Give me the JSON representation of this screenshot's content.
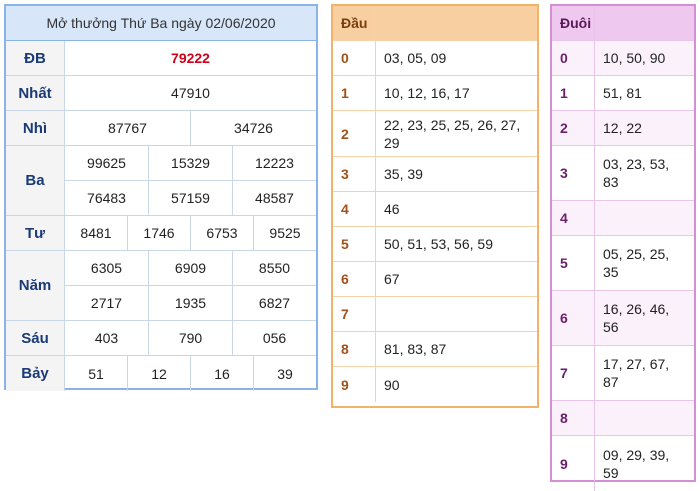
{
  "results": {
    "title": "Mở thưởng Thứ Ba ngày 02/06/2020",
    "prizes": [
      {
        "label": "ĐB",
        "lines": [
          [
            "79222"
          ]
        ],
        "special": true
      },
      {
        "label": "Nhất",
        "lines": [
          [
            "47910"
          ]
        ]
      },
      {
        "label": "Nhì",
        "lines": [
          [
            "87767",
            "34726"
          ]
        ]
      },
      {
        "label": "Ba",
        "lines": [
          [
            "99625",
            "15329",
            "12223"
          ],
          [
            "76483",
            "57159",
            "48587"
          ]
        ]
      },
      {
        "label": "Tư",
        "lines": [
          [
            "8481",
            "1746",
            "6753",
            "9525"
          ]
        ]
      },
      {
        "label": "Năm",
        "lines": [
          [
            "6305",
            "6909",
            "8550"
          ],
          [
            "2717",
            "1935",
            "6827"
          ]
        ]
      },
      {
        "label": "Sáu",
        "lines": [
          [
            "403",
            "790",
            "056"
          ]
        ]
      },
      {
        "label": "Bảy",
        "lines": [
          [
            "51",
            "12",
            "16",
            "39"
          ]
        ]
      }
    ]
  },
  "dau": {
    "header": "Đầu",
    "rows": [
      {
        "key": "0",
        "value": "03, 05, 09"
      },
      {
        "key": "1",
        "value": "10, 12, 16, 17"
      },
      {
        "key": "2",
        "value": "22, 23, 25, 25, 26, 27, 29"
      },
      {
        "key": "3",
        "value": "35, 39"
      },
      {
        "key": "4",
        "value": "46"
      },
      {
        "key": "5",
        "value": "50, 51, 53, 56, 59"
      },
      {
        "key": "6",
        "value": "67"
      },
      {
        "key": "7",
        "value": ""
      },
      {
        "key": "8",
        "value": "81, 83, 87"
      },
      {
        "key": "9",
        "value": "90"
      }
    ]
  },
  "duoi": {
    "header": "Đuôi",
    "rows": [
      {
        "key": "0",
        "value": "10, 50, 90"
      },
      {
        "key": "1",
        "value": "51, 81"
      },
      {
        "key": "2",
        "value": "12, 22"
      },
      {
        "key": "3",
        "value": "03, 23, 53, 83"
      },
      {
        "key": "4",
        "value": ""
      },
      {
        "key": "5",
        "value": "05, 25, 25, 35"
      },
      {
        "key": "6",
        "value": "16, 26, 46, 56"
      },
      {
        "key": "7",
        "value": "17, 27, 67, 87"
      },
      {
        "key": "8",
        "value": ""
      },
      {
        "key": "9",
        "value": "09, 29, 39, 59"
      }
    ]
  },
  "colors": {
    "special_prize": "#d0021b",
    "results_border": "#8ab4e8",
    "dau_border": "#f2b26a",
    "duoi_border": "#d48fd4"
  }
}
